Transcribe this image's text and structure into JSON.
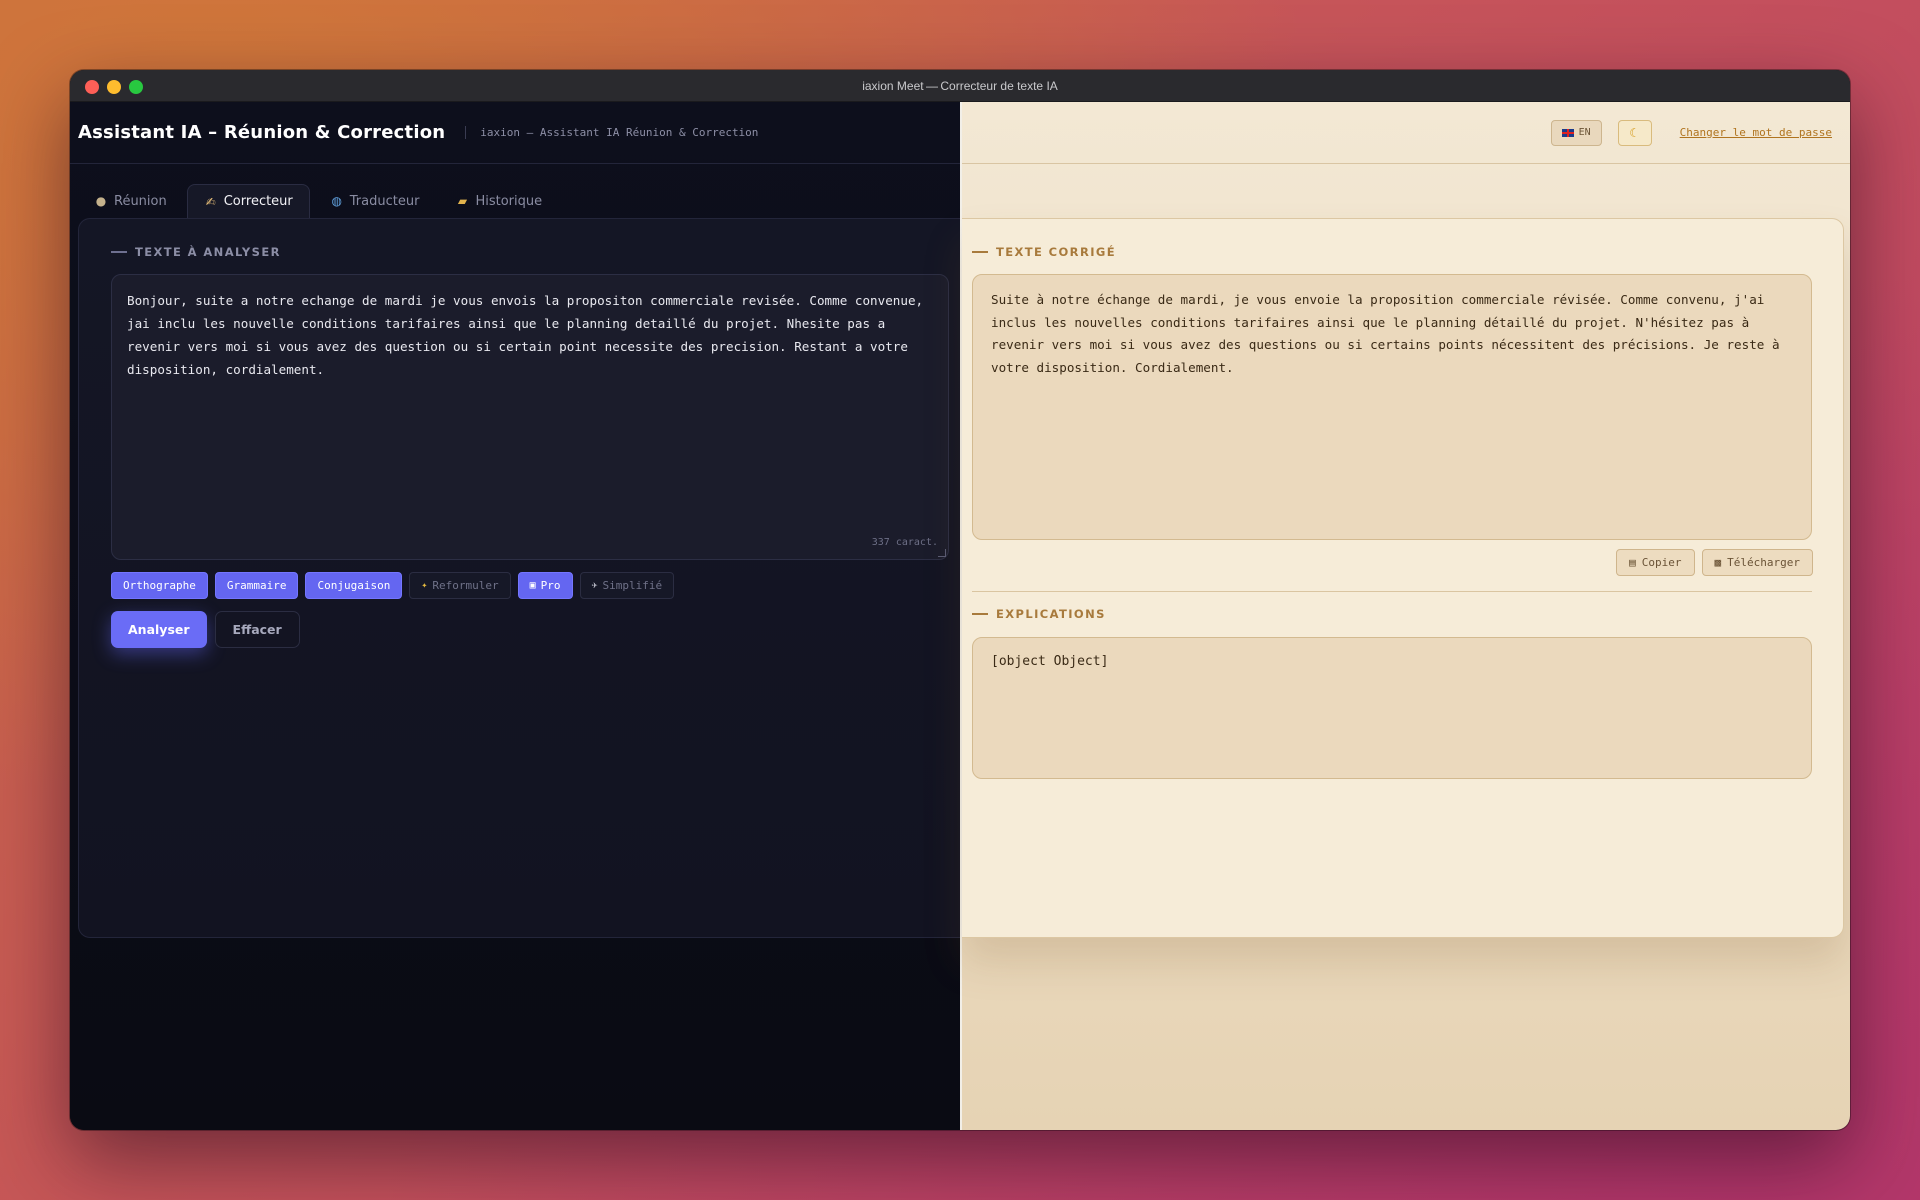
{
  "window": {
    "title": "iaxion Meet — Correcteur de texte IA"
  },
  "header": {
    "app_title": "Assistant IA – Réunion & Correction",
    "subtitle": "iaxion — Assistant IA Réunion & Correction",
    "lang_label": "EN",
    "change_password": "Changer le mot de passe"
  },
  "tabs": [
    {
      "label": "Réunion",
      "icon": "microphone-icon",
      "active": false
    },
    {
      "label": "Correcteur",
      "icon": "writing-hand-icon",
      "active": true
    },
    {
      "label": "Traducteur",
      "icon": "globe-icon",
      "active": false
    },
    {
      "label": "Historique",
      "icon": "folder-icon",
      "active": false
    }
  ],
  "input": {
    "section_label": "TEXTE À ANALYSER",
    "text": "Bonjour, suite a notre echange de mardi je vous envois la propositon commerciale revisée. Comme convenue, jai inclu les nouvelle conditions tarifaires ainsi que le planning detaillé du projet. Nhesite pas a revenir vers moi si vous avez des question ou si certain point necessite des precision. Restant a votre disposition, cordialement.",
    "char_count": "337 caract."
  },
  "options": [
    {
      "label": "Orthographe",
      "active": true,
      "icon": ""
    },
    {
      "label": "Grammaire",
      "active": true,
      "icon": ""
    },
    {
      "label": "Conjugaison",
      "active": true,
      "icon": ""
    },
    {
      "label": "Reformuler",
      "active": false,
      "icon": "sparkles-icon"
    },
    {
      "label": "Pro",
      "active": true,
      "icon": "briefcase-icon"
    },
    {
      "label": "Simplifié",
      "active": false,
      "icon": "dove-icon"
    }
  ],
  "actions": {
    "analyze": "Analyser",
    "clear": "Effacer"
  },
  "output": {
    "section_label": "TEXTE CORRIGÉ",
    "text": "Suite à notre échange de mardi, je vous envoie la proposition commerciale révisée. Comme convenu, j'ai inclus les nouvelles conditions tarifaires ainsi que le planning détaillé du projet. N'hésitez pas à revenir vers moi si vous avez des questions ou si certains points nécessitent des précisions. Je reste à votre disposition. Cordialement.",
    "copy": "Copier",
    "download": "Télécharger"
  },
  "explanations": {
    "section_label": "EXPLICATIONS",
    "text": "[object Object]"
  },
  "colors": {
    "accent": "#6466f1",
    "dark_bg": "#0d0f1c",
    "light_bg": "#f3e8d4",
    "light_accent": "#a87a3c"
  }
}
